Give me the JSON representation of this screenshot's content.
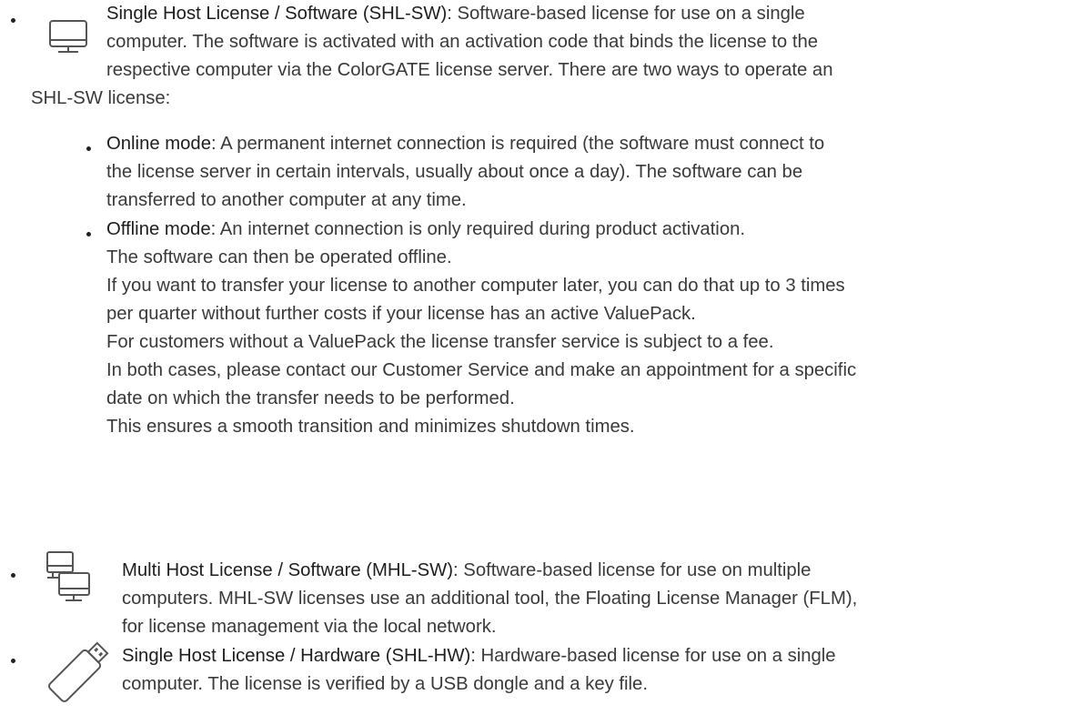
{
  "entries": [
    {
      "icon": "desktop-monitor-icon",
      "term": "Single Host License / Software (SHL-SW)",
      "lines": [
        ": Software-based license for use on a single",
        "computer. The software is activated with an activation code that binds the license to the",
        "respective computer via the ColorGATE license server. There are two ways to operate an",
        "SHL-SW license:"
      ],
      "sub_items": [
        {
          "term": "Online mode",
          "lines": [
            ": A permanent internet connection is required (the software must connect to",
            "the license server in certain intervals, usually about once a day). The software can be",
            "transferred to another computer at any time."
          ]
        },
        {
          "term": "Offline mode",
          "lines": [
            ": An internet connection is only required during product activation.",
            "The software can then be operated offline.",
            "If you want to transfer your license to another computer later, you can do that up to 3 times",
            "per quarter without further costs if your license has an active ValuePack.",
            "For customers without a ValuePack the license transfer service is subject to a fee.",
            "In both cases, please contact our Customer Service and make an appointment for a specific",
            "date on which the transfer needs to be performed.",
            "This ensures a smooth transition and minimizes shutdown times."
          ]
        }
      ]
    },
    {
      "icon": "multiple-monitors-icon",
      "term": "Multi Host License / Software (MHL-SW)",
      "lines": [
        ": Software-based license for use on multiple",
        "computers. MHL-SW licenses use an additional tool, the Floating License Manager (FLM),",
        "for license management via the local network."
      ]
    },
    {
      "icon": "usb-dongle-icon",
      "term": "Single Host License / Hardware (SHL-HW)",
      "lines": [
        ": Hardware-based license for use on a single",
        "computer. The license is verified by a USB dongle and a key file."
      ]
    }
  ]
}
